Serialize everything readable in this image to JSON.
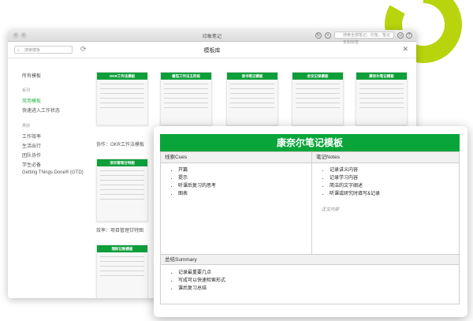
{
  "window": {
    "title": "印象笔记",
    "search_placeholder": "搜索全部笔记、印象，笔记本和标签"
  },
  "toolbar": {
    "search_placeholder": "搜索模板",
    "title": "模板库"
  },
  "sidebar": {
    "all": "所有模板",
    "series_head": "系列",
    "series": [
      "常用模板",
      "快速进入工作状态"
    ],
    "category_head": "类别",
    "categories": [
      "工作效率",
      "生活出行",
      "团队协作",
      "学生必备",
      "Getting Things Done® (GTD)"
    ]
  },
  "cards": [
    {
      "title": "OKR工作法模板",
      "caption": "协作：OKR工作法模板"
    },
    {
      "title": "番茄工作法五阶段",
      "caption": ""
    },
    {
      "title": "读书笔记模板",
      "caption": ""
    },
    {
      "title": "会议记录模板",
      "caption": ""
    },
    {
      "title": "康奈尔笔记模板",
      "caption": ""
    },
    {
      "title": "项目管理甘特图",
      "caption": "效率：项目管理甘特图"
    },
    {
      "title": "理财记账模板",
      "caption": ""
    }
  ],
  "detail": {
    "title": "康奈尔笔记模板",
    "cues_head": "线索Cues",
    "cues": [
      "开篇",
      "提示",
      "听课后复习的思考",
      "图表"
    ],
    "notes_head": "笔记Notes",
    "notes": [
      "记录讲义内容",
      "记录学习内容",
      "简洁的文字阐述",
      "听课或研究时填写&记录"
    ],
    "notes_body": "正文内容",
    "summary_head": "总结Summary",
    "summary": [
      "记录最重要几点",
      "写成可以快速检索形式",
      "课后复习总结"
    ]
  },
  "colors": {
    "accent": "#0aa53a",
    "ring": "#b7d40d"
  }
}
